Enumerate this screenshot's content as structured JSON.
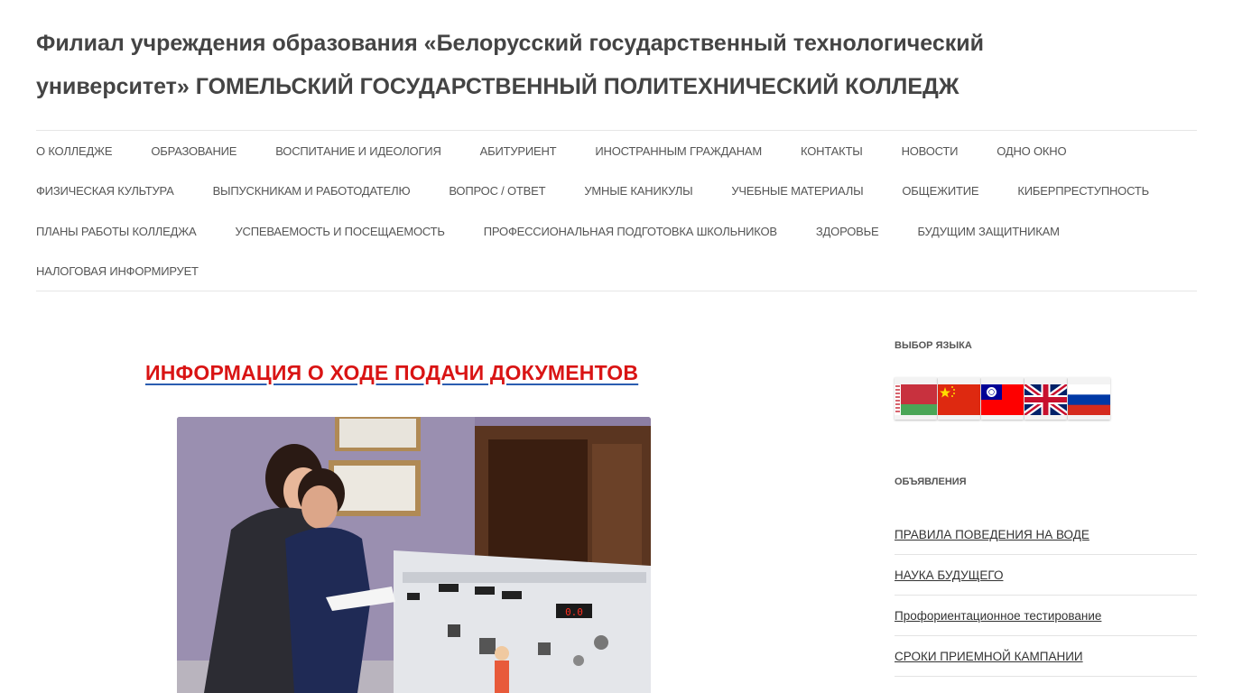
{
  "site": {
    "title_line1": "Филиал учреждения образования «Белорусский государственный технологический",
    "title_line2": "университет» ГОМЕЛЬСКИЙ ГОСУДАРСТВЕННЫЙ ПОЛИТЕХНИЧЕСКИЙ КОЛЛЕДЖ"
  },
  "nav": {
    "row1": [
      "О КОЛЛЕДЖЕ",
      "ОБРАЗОВАНИЕ",
      "ВОСПИТАНИЕ И ИДЕОЛОГИЯ",
      "АБИТУРИЕНТ",
      "ИНОСТРАННЫМ ГРАЖДАНАМ",
      "КОНТАКТЫ",
      "НОВОСТИ",
      "ОДНО ОКНО"
    ],
    "row2": [
      "ФИЗИЧЕСКАЯ КУЛЬТУРА",
      "ВЫПУСКНИКАМ И РАБОТОДАТЕЛЮ",
      "ВОПРОС / ОТВЕТ",
      "УМНЫЕ КАНИКУЛЫ",
      "УЧЕБНЫЕ МАТЕРИАЛЫ",
      "ОБЩЕЖИТИЕ",
      "КИБЕРПРЕСТУПНОСТЬ"
    ],
    "row3": [
      "ПЛАНЫ РАБОТЫ КОЛЛЕДЖА",
      "УСПЕВАЕМОСТЬ И ПОСЕЩАЕМОСТЬ",
      "ПРОФЕССИОНАЛЬНАЯ ПОДГОТОВКА ШКОЛЬНИКОВ",
      "ЗДОРОВЬЕ",
      "БУДУЩИМ ЗАЩИТНИКАМ"
    ],
    "row4": [
      "НАЛОГОВАЯ ИНФОРМИРУЕТ"
    ]
  },
  "main": {
    "heading": "ИНФОРМАЦИЯ О ХОДЕ ПОДАЧИ ДОКУМЕНТОВ",
    "photo_display_values": [
      "0.0"
    ]
  },
  "sidebar": {
    "language_title": "ВЫБОР ЯЗЫКА",
    "flags": [
      "belarus-flag-icon",
      "china-flag-icon",
      "taiwan-flag-icon",
      "uk-flag-icon",
      "russia-flag-icon"
    ],
    "announcements_title": "ОБЪЯВЛЕНИЯ",
    "announcements": [
      "ПРАВИЛА ПОВЕДЕНИЯ НА ВОДЕ",
      "НАУКА БУДУЩЕГО",
      "Профориентационное тестирование",
      "СРОКИ ПРИЕМНОЙ КАМПАНИИ"
    ]
  },
  "colors": {
    "heading_red": "#d91414",
    "underline_blue": "#2a5db0",
    "text_gray": "#555555",
    "divider": "#e6e6e6"
  }
}
